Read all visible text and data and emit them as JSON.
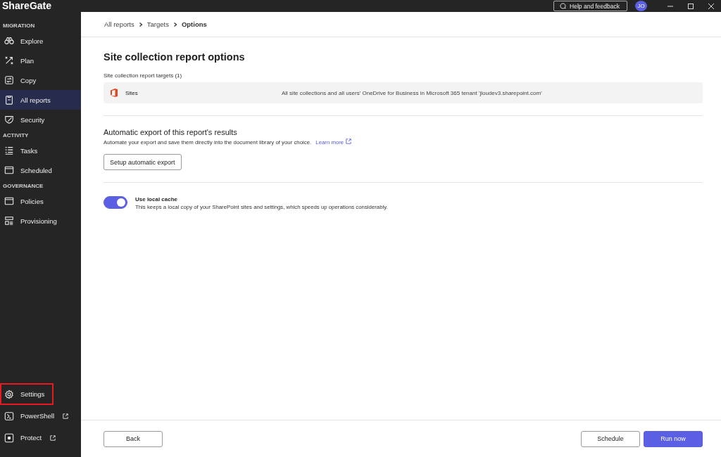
{
  "app": {
    "logo": "ShareGate"
  },
  "sidebar": {
    "sections": [
      {
        "header": "MIGRATION",
        "items": [
          {
            "label": "Explore",
            "kind": "binoculars",
            "selected": false
          },
          {
            "label": "Plan",
            "kind": "plan",
            "selected": false
          },
          {
            "label": "Copy",
            "kind": "copy",
            "selected": false
          },
          {
            "label": "All reports",
            "kind": "clipboard",
            "selected": true
          },
          {
            "label": "Security",
            "kind": "shield",
            "selected": false
          }
        ]
      },
      {
        "header": "ACTIVITY",
        "items": [
          {
            "label": "Tasks",
            "kind": "tasks",
            "selected": false
          },
          {
            "label": "Scheduled",
            "kind": "calendar",
            "selected": false
          }
        ]
      },
      {
        "header": "GOVERNANCE",
        "items": [
          {
            "label": "Policies",
            "kind": "calendar",
            "selected": false
          },
          {
            "label": "Provisioning",
            "kind": "provisioning",
            "selected": false
          }
        ]
      }
    ],
    "bottom_items": [
      {
        "label": "Settings",
        "kind": "gear",
        "external": false,
        "highlighted": true
      },
      {
        "label": "PowerShell",
        "kind": "terminal",
        "external": true,
        "highlighted": false
      },
      {
        "label": "Protect",
        "kind": "protect",
        "external": true,
        "highlighted": false
      }
    ]
  },
  "title_bar": {
    "help_button": "Help and feedback",
    "avatar": "JO"
  },
  "breadcrumb": [
    {
      "label": "All reports",
      "current": false
    },
    {
      "label": "Targets",
      "current": false
    },
    {
      "label": "Options",
      "current": true
    }
  ],
  "page_title": "Site collection report options",
  "targets": {
    "label": "Site collection report targets (1)",
    "rows": [
      {
        "name": "Sites",
        "description": "All site collections and all users' OneDrive for Business in Microsoft 365 tenant 'jloudev3.sharepoint.com'"
      }
    ]
  },
  "export": {
    "title": "Automatic export of this report's results",
    "description": "Automate your export and save them directly into the document library of your choice.",
    "link": "Learn more",
    "button": "Setup automatic export"
  },
  "cache": {
    "on": true,
    "label": "Use local cache",
    "description": "This keeps a local copy of your SharePoint sites and settings, which speeds up operations considerably."
  },
  "footer": {
    "back": "Back",
    "schedule": "Schedule",
    "run": "Run now"
  }
}
